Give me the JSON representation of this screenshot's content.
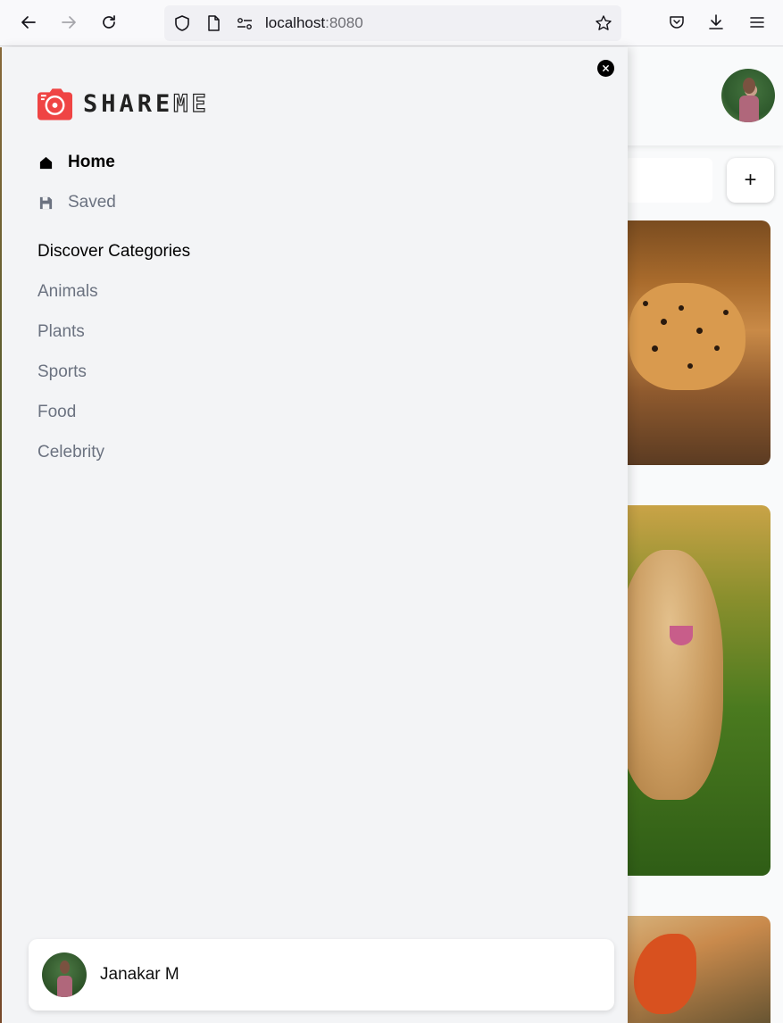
{
  "browser": {
    "url_host": "localhost",
    "url_port": ":8080"
  },
  "sidebar": {
    "logo": {
      "text_bold": "SHARE",
      "text_thin": "ME",
      "accent": "#ef4444"
    },
    "nav": [
      {
        "label": "Home",
        "icon": "home-icon",
        "active": true
      },
      {
        "label": "Saved",
        "icon": "save-icon",
        "active": false
      }
    ],
    "categories_title": "Discover Categories",
    "categories": [
      "Animals",
      "Plants",
      "Sports",
      "Food",
      "Celebrity"
    ],
    "user": {
      "name": "Janakar M"
    }
  },
  "main": {
    "add_button_label": "+"
  }
}
